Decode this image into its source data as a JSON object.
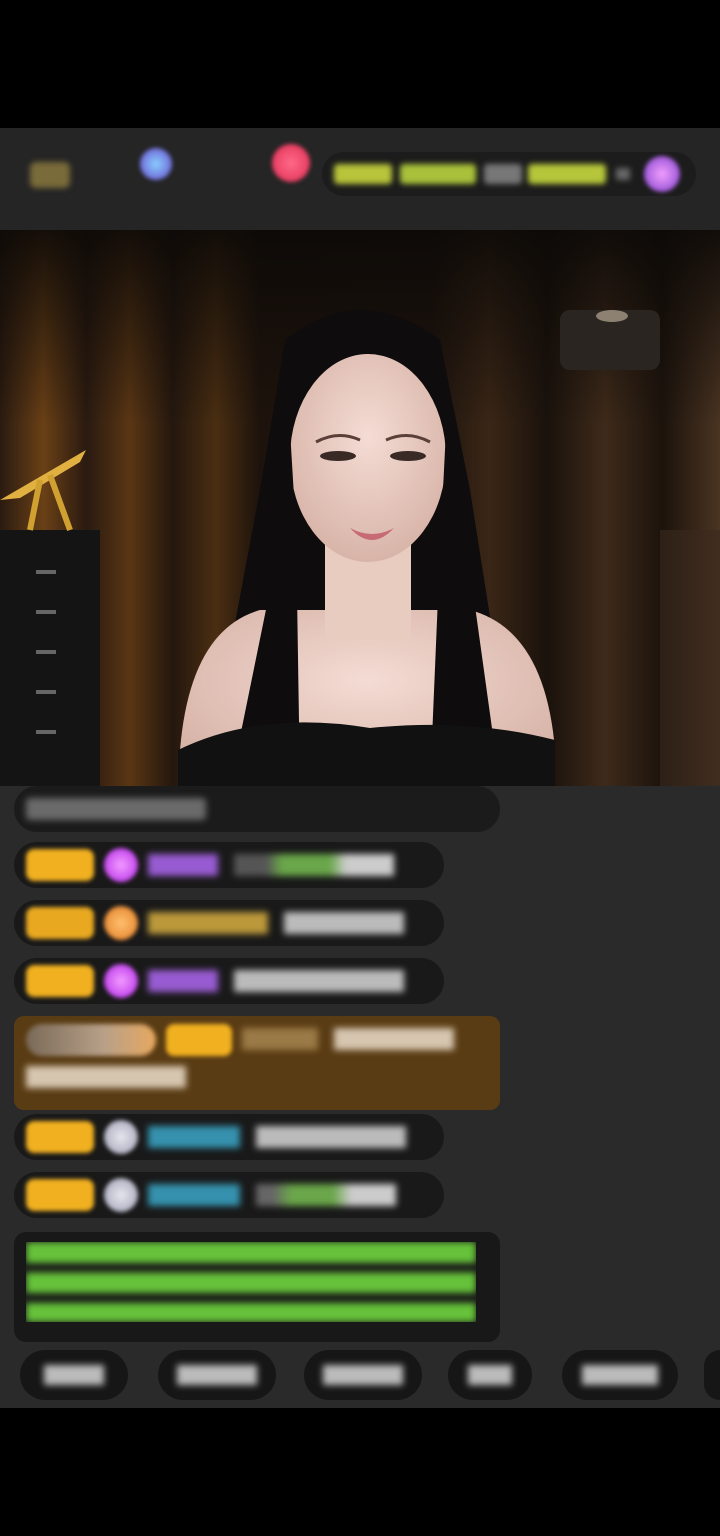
{
  "top_bar": {
    "level_badge": "",
    "viewer_label": "",
    "fan_club": "",
    "rank_tags": [
      "",
      "",
      "",
      ""
    ]
  },
  "chat": {
    "system_notice": "",
    "messages": [
      {
        "tag": "",
        "user": "",
        "text": ""
      },
      {
        "tag": "",
        "user": "",
        "text": ""
      },
      {
        "tag": "",
        "user": "",
        "text": ""
      },
      {
        "tag": "",
        "user": "",
        "text": ""
      },
      {
        "tag": "",
        "user": "",
        "text": ""
      },
      {
        "tag": "",
        "user": "",
        "text": ""
      }
    ],
    "announcement": ""
  },
  "quick_replies": [
    "",
    "",
    "",
    "",
    ""
  ],
  "colors": {
    "tag_gold": "#f0b020",
    "highlight_bg": "#5a3c14",
    "announcement_text": "#66c23a",
    "username_cyan": "#3aa7c8",
    "username_purple": "#b86cff",
    "username_gold": "#d8b040"
  },
  "icons": {
    "diamond": "diamond-icon",
    "gift": "gift-icon",
    "heart": "heart-icon"
  }
}
